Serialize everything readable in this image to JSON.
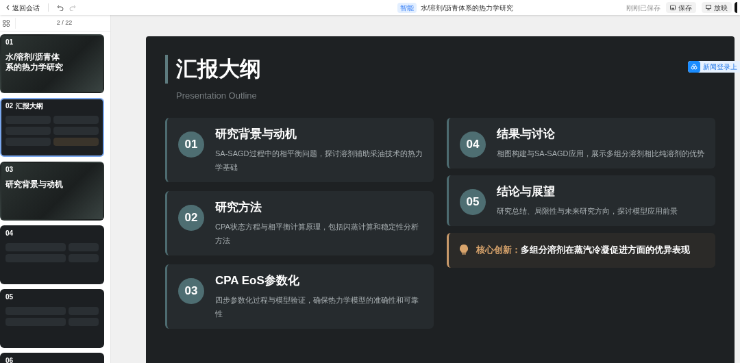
{
  "toolbar": {
    "back": "返回会话",
    "badge": "智能",
    "doc_title": "水/溶剂/沥青体系的热力学研究",
    "save_status": "刚刚已保存",
    "save": "保存",
    "present": "放映"
  },
  "sidebar": {
    "page_counter": "2 / 22",
    "thumbnails": [
      {
        "number": "01",
        "title": "水/溶剂/沥青体系的热力学研究",
        "selected": false,
        "kind": "cover"
      },
      {
        "number": "02",
        "title": "汇报大纲",
        "selected": true,
        "kind": "outline"
      },
      {
        "number": "03",
        "title": "研究背景与动机",
        "selected": false,
        "kind": "cover"
      },
      {
        "number": "04",
        "selected": false,
        "kind": "content"
      },
      {
        "number": "05",
        "selected": false,
        "kind": "content"
      },
      {
        "number": "06",
        "selected": false,
        "kind": "partial"
      }
    ]
  },
  "floating_tag": "新闻登录上",
  "slide": {
    "title": "汇报大纲",
    "subtitle": "Presentation Outline",
    "left_items": [
      {
        "number": "01",
        "title": "研究背景与动机",
        "desc": "SA-SAGD过程中的相平衡问题，探讨溶剂辅助采油技术的热力学基础"
      },
      {
        "number": "02",
        "title": "研究方法",
        "desc": "CPA状态方程与相平衡计算原理，包括闪蒸计算和稳定性分析方法"
      },
      {
        "number": "03",
        "title": "CPA EoS参数化",
        "desc": "四步参数化过程与模型验证，确保热力学模型的准确性和可靠性"
      }
    ],
    "right_items": [
      {
        "number": "04",
        "title": "结果与讨论",
        "desc": "相图构建与SA-SAGD应用，展示多组分溶剂相比纯溶剂的优势"
      },
      {
        "number": "05",
        "title": "结论与展望",
        "desc": "研究总结、局限性与未来研究方向，探讨模型应用前景"
      }
    ],
    "highlight": {
      "label": "核心创新：",
      "text": "多组分溶剂在蒸汽冷凝促进方面的优异表现"
    }
  }
}
